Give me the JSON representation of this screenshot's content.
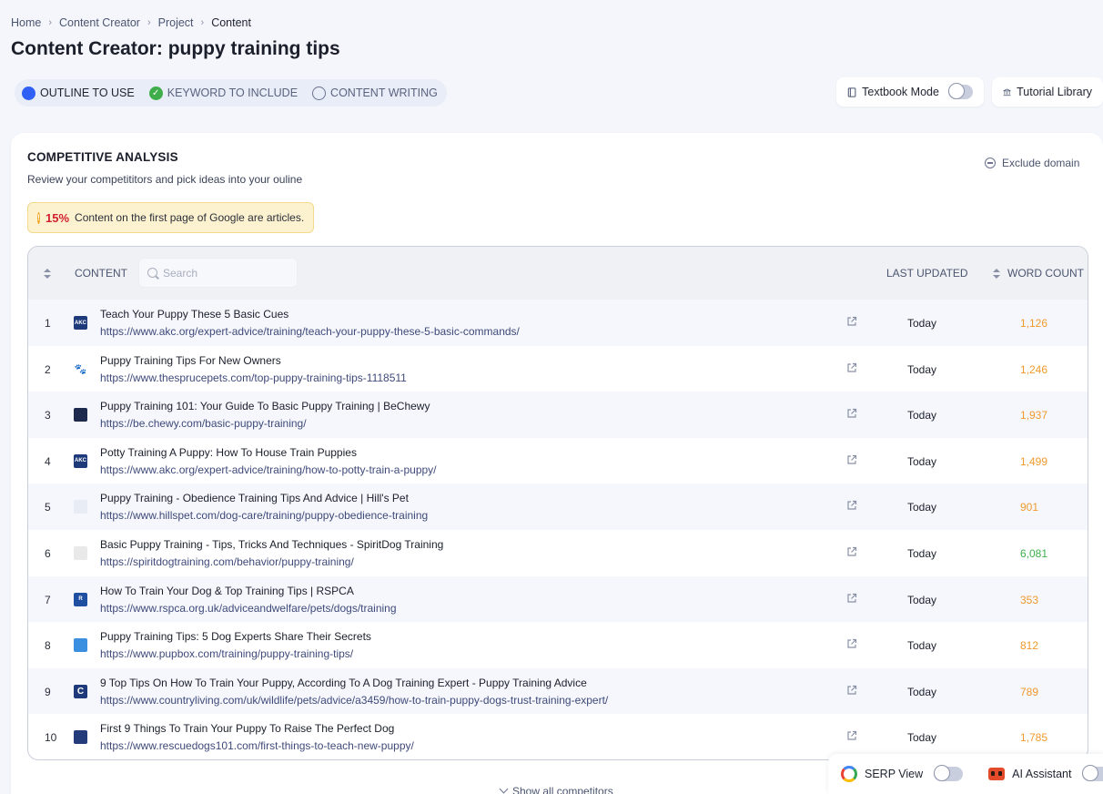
{
  "breadcrumb": [
    "Home",
    "Content Creator",
    "Project",
    "Content"
  ],
  "page_title": {
    "prefix": "Content Creator:",
    "keyword": "puppy training tips"
  },
  "steps": [
    {
      "label": "OUTLINE TO USE",
      "state": "active"
    },
    {
      "label": "KEYWORD TO INCLUDE",
      "state": "done"
    },
    {
      "label": "CONTENT WRITING",
      "state": "pending"
    }
  ],
  "toolbar": {
    "textbook_label": "Textbook Mode",
    "textbook_on": false,
    "tutorial_label": "Tutorial Library"
  },
  "analysis": {
    "title": "COMPETITIVE ANALYSIS",
    "subtitle": "Review your competititors and pick ideas into your ouline",
    "exclude_label": "Exclude domain",
    "notice_pct": "15%",
    "notice_text": "Content on the first page of Google are articles."
  },
  "table": {
    "headers": {
      "content": "CONTENT",
      "last_updated": "LAST UPDATED",
      "word_count": "WORD COUNT"
    },
    "search_placeholder": "Search",
    "rows": [
      {
        "num": "1",
        "title": "Teach Your Puppy These 5 Basic Cues",
        "url": "https://www.akc.org/expert-advice/training/teach-your-puppy-these-5-basic-commands/",
        "date": "Today",
        "wc": "1,126",
        "icon": "akc"
      },
      {
        "num": "2",
        "title": "Puppy Training Tips For New Owners",
        "url": "https://www.thesprucepets.com/top-puppy-training-tips-1118511",
        "date": "Today",
        "wc": "1,246",
        "icon": "paw"
      },
      {
        "num": "3",
        "title": "Puppy Training 101: Your Guide To Basic Puppy Training | BeChewy",
        "url": "https://be.chewy.com/basic-puppy-training/",
        "date": "Today",
        "wc": "1,937",
        "icon": "chewy"
      },
      {
        "num": "4",
        "title": "Potty Training A Puppy: How To House Train Puppies",
        "url": "https://www.akc.org/expert-advice/training/how-to-potty-train-a-puppy/",
        "date": "Today",
        "wc": "1,499",
        "icon": "akc"
      },
      {
        "num": "5",
        "title": "Puppy Training - Obedience Training Tips And Advice | Hill's Pet",
        "url": "https://www.hillspet.com/dog-care/training/puppy-obedience-training",
        "date": "Today",
        "wc": "901",
        "icon": "hills"
      },
      {
        "num": "6",
        "title": "Basic Puppy Training - Tips, Tricks And Techniques - SpiritDog Training",
        "url": "https://spiritdogtraining.com/behavior/puppy-training/",
        "date": "Today",
        "wc": "6,081",
        "icon": "spirit",
        "wc_color": "green"
      },
      {
        "num": "7",
        "title": "How To Train Your Dog & Top Training Tips | RSPCA",
        "url": "https://www.rspca.org.uk/adviceandwelfare/pets/dogs/training",
        "date": "Today",
        "wc": "353",
        "icon": "rspca"
      },
      {
        "num": "8",
        "title": "Puppy Training Tips: 5 Dog Experts Share Their Secrets",
        "url": "https://www.pupbox.com/training/puppy-training-tips/",
        "date": "Today",
        "wc": "812",
        "icon": "pupbox"
      },
      {
        "num": "9",
        "title": "9 Top Tips On How To Train Your Puppy, According To A Dog Training Expert - Puppy Training Advice",
        "url": "https://www.countryliving.com/uk/wildlife/pets/advice/a3459/how-to-train-puppy-dogs-trust-training-expert/",
        "date": "Today",
        "wc": "789",
        "icon": "country"
      },
      {
        "num": "10",
        "title": "First 9 Things To Train Your Puppy To Raise The Perfect Dog",
        "url": "https://www.rescuedogs101.com/first-things-to-teach-new-puppy/",
        "date": "Today",
        "wc": "1,785",
        "icon": "rescue"
      }
    ]
  },
  "show_all_label": "Show all competitors",
  "dock": {
    "serp_label": "SERP View",
    "serp_on": false,
    "ai_label": "AI Assistant",
    "ai_on": false
  },
  "colors": {
    "accent": "#2f5ff5",
    "done": "#3fae4a",
    "word_count": "#f09a2e",
    "word_count_high": "#3fae4a",
    "notice_pct": "#d1202d"
  }
}
